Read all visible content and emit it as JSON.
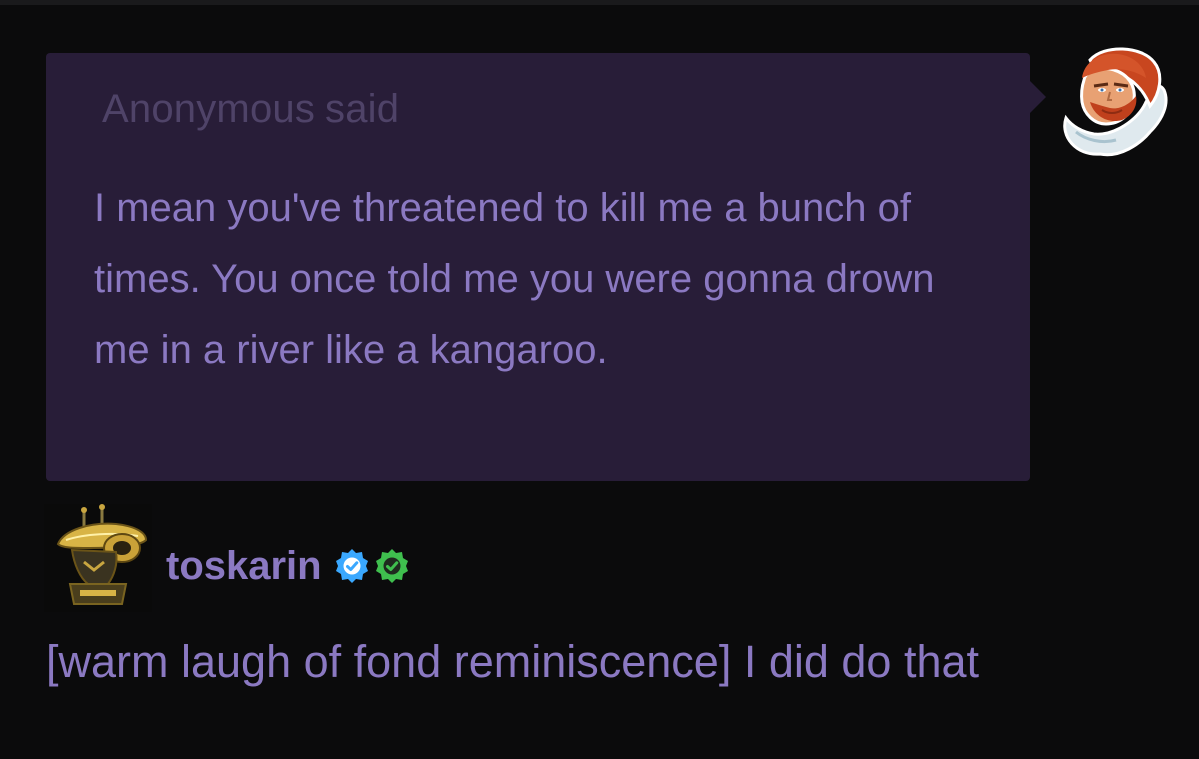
{
  "ask": {
    "asker_name": "Anonymous",
    "said_label": "said",
    "body": "I mean you've threatened to kill me a bunch of times. You once told me you were gonna drown me in a river like a kangaroo."
  },
  "reply": {
    "username": "toskarin",
    "text": "[warm laugh of fond reminiscence] I did do that",
    "badges": [
      {
        "icon": "verified-check-badge-icon",
        "color": "#3aa8ff"
      },
      {
        "icon": "verified-check-badge-icon",
        "color": "#3fbf4e"
      }
    ]
  },
  "colors": {
    "background": "#0b0b0c",
    "bubble": "#281d38",
    "text_purple": "#8b79c2",
    "asker_dim": "#4f4368"
  }
}
